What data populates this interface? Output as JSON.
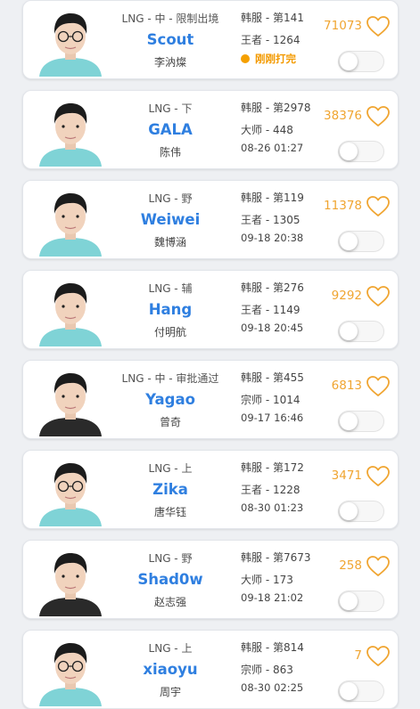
{
  "colors": {
    "name": "#2f7fe0",
    "likes": "#f0a531",
    "live": "#f5a000",
    "jersey_light": "#7fd3d6",
    "jersey_dark": "#2a2a2a"
  },
  "players": [
    {
      "team_line": "LNG - 中 - 限制出境",
      "name": "Scout",
      "cn": "李汭燦",
      "server": "韩服 - 第141",
      "rank": "王者 - 1264",
      "status": "刚刚打完",
      "live": true,
      "likes": "71073",
      "toggle_on": false,
      "jersey": "light",
      "glasses": true
    },
    {
      "team_line": "LNG - 下",
      "name": "GALA",
      "cn": "陈伟",
      "server": "韩服 - 第2978",
      "rank": "大师 - 448",
      "status": "08-26 01:27",
      "live": false,
      "likes": "38376",
      "toggle_on": false,
      "jersey": "light",
      "glasses": false
    },
    {
      "team_line": "LNG - 野",
      "name": "Weiwei",
      "cn": "魏博涵",
      "server": "韩服 - 第119",
      "rank": "王者 - 1305",
      "status": "09-18 20:38",
      "live": false,
      "likes": "11378",
      "toggle_on": false,
      "jersey": "light",
      "glasses": false
    },
    {
      "team_line": "LNG - 辅",
      "name": "Hang",
      "cn": "付明航",
      "server": "韩服 - 第276",
      "rank": "王者 - 1149",
      "status": "09-18 20:45",
      "live": false,
      "likes": "9292",
      "toggle_on": false,
      "jersey": "light",
      "glasses": false
    },
    {
      "team_line": "LNG - 中 - 审批通过",
      "name": "Yagao",
      "cn": "曾奇",
      "server": "韩服 - 第455",
      "rank": "宗师 - 1014",
      "status": "09-17 16:46",
      "live": false,
      "likes": "6813",
      "toggle_on": false,
      "jersey": "dark",
      "glasses": false
    },
    {
      "team_line": "LNG - 上",
      "name": "Zika",
      "cn": "唐华钰",
      "server": "韩服 - 第172",
      "rank": "王者 - 1228",
      "status": "08-30 01:23",
      "live": false,
      "likes": "3471",
      "toggle_on": false,
      "jersey": "light",
      "glasses": true
    },
    {
      "team_line": "LNG - 野",
      "name": "Shad0w",
      "cn": "赵志强",
      "server": "韩服 - 第7673",
      "rank": "大师 - 173",
      "status": "09-18 21:02",
      "live": false,
      "likes": "258",
      "toggle_on": false,
      "jersey": "dark",
      "glasses": false
    },
    {
      "team_line": "LNG - 上",
      "name": "xiaoyu",
      "cn": "周宇",
      "server": "韩服 - 第814",
      "rank": "宗师 - 863",
      "status": "08-30 02:25",
      "live": false,
      "likes": "7",
      "toggle_on": false,
      "jersey": "light",
      "glasses": true
    }
  ]
}
